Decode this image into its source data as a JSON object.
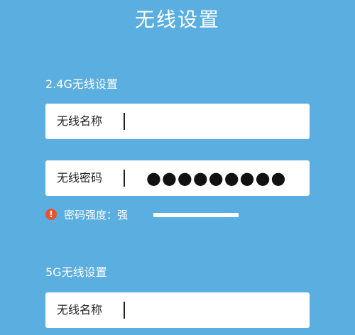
{
  "title": "无线设置",
  "band24": {
    "section_label": "2.4G无线设置",
    "ssid_label": "无线名称",
    "ssid_value": "",
    "password_label": "无线密码",
    "password_value": "●●●●●●●●●",
    "strength": {
      "text": "密码强度：强",
      "icon": "warning-icon",
      "level": 1.0
    }
  },
  "band5": {
    "section_label": "5G无线设置",
    "ssid_label": "无线名称",
    "ssid_value": ""
  },
  "colors": {
    "background": "#5aaee0",
    "field": "#ffffff",
    "warning": "#e8532f"
  }
}
